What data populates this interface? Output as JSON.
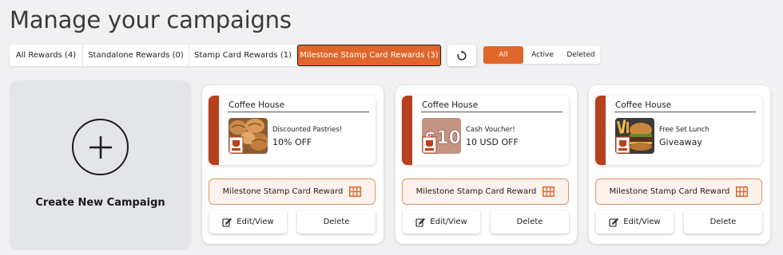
{
  "page": {
    "title": "Manage your campaigns"
  },
  "tabs": [
    {
      "label": "All Rewards (4)"
    },
    {
      "label": "Standalone Rewards (0)"
    },
    {
      "label": "Stamp Card Rewards (1)"
    },
    {
      "label": "Milestone Stamp Card Rewards (3)",
      "active": true
    }
  ],
  "refresh": {
    "icon": "refresh-icon"
  },
  "filters": [
    {
      "label": "All",
      "active": true
    },
    {
      "label": "Active"
    },
    {
      "label": "Deleted"
    }
  ],
  "create_card": {
    "label": "Create New Campaign",
    "icon": "plus-icon"
  },
  "campaigns": [
    {
      "merchant": "Coffee House",
      "reward_name": "Discounted Pastries!",
      "reward_value": "10% OFF",
      "image": "pastries",
      "type_label": "Milestone Stamp Card Reward",
      "edit_label": "Edit/View",
      "delete_label": "Delete"
    },
    {
      "merchant": "Coffee House",
      "reward_name": "Cash Voucher!",
      "reward_value": "10 USD OFF",
      "image": "ten-dollar-voucher",
      "image_text": "$10",
      "type_label": "Milestone Stamp Card Reward",
      "edit_label": "Edit/View",
      "delete_label": "Delete"
    },
    {
      "merchant": "Coffee House",
      "reward_name": "Free Set Lunch",
      "reward_value": "Giveaway",
      "image": "burger-and-fries",
      "type_label": "Milestone Stamp Card Reward",
      "edit_label": "Edit/View",
      "delete_label": "Delete"
    }
  ],
  "colors": {
    "accent": "#e0662c",
    "card_bar": "#b5411d",
    "badge_border": "#e4915f",
    "badge_bg": "#fdf2ec"
  }
}
